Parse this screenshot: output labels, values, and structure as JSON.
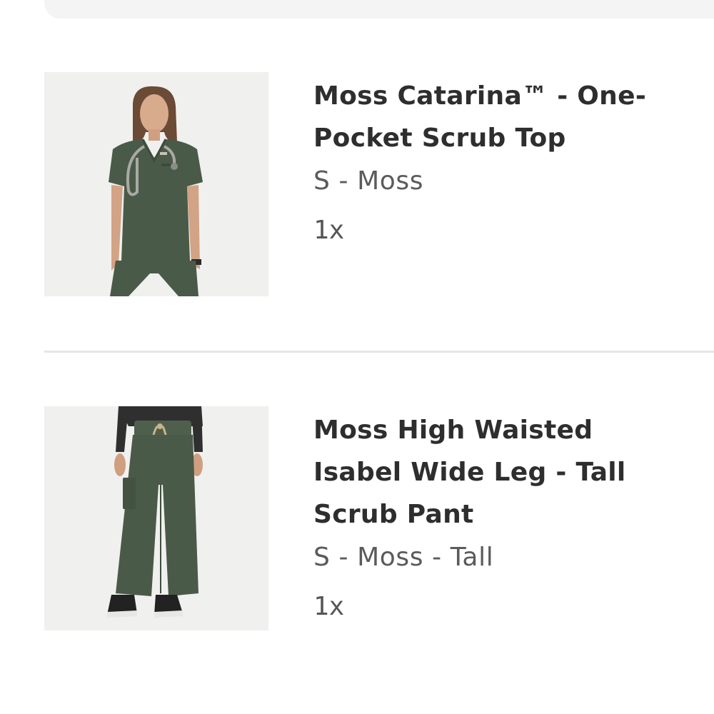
{
  "cart": {
    "items": [
      {
        "title": "Moss Catarina™ - One-Pocket Scrub Top",
        "variant": "S - Moss",
        "quantity": "1x",
        "image_name": "scrub-top-photo"
      },
      {
        "title": "Moss High Waisted Isabel Wide Leg - Tall Scrub Pant",
        "variant": "S - Moss - Tall",
        "quantity": "1x",
        "image_name": "scrub-pant-photo"
      }
    ]
  },
  "colors": {
    "moss": "#4a5a48",
    "background": "#ffffff",
    "image_bg": "#f0f0ef",
    "title_text": "#2e2e2e",
    "secondary_text": "#5b5b5b",
    "divider": "#e6e6e6"
  }
}
